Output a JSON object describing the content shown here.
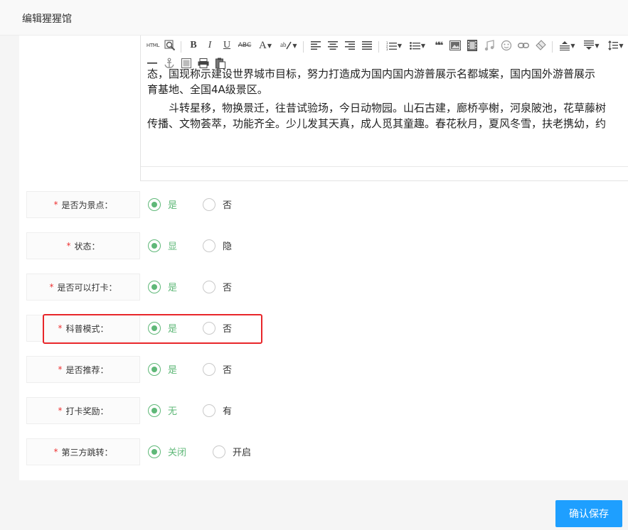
{
  "dialog": {
    "title": "编辑猩猩馆"
  },
  "editor": {
    "toolbar": {
      "html_label": "HTML",
      "bold": "B",
      "italic": "I",
      "underline": "U",
      "strike": "ABC",
      "font_color": "A",
      "quote": "❝❝"
    },
    "content_lines": [
      "态，国现称示建设世界城市目标，努力打造成为国内国内游普展示名都城案，国内国外游普展示",
      "育基地、全国4A级景区。",
      "斗转星移，物换景迁，往昔试验场，今日动物园。山石古建，廊桥亭榭，河泉陂池，花草藤树",
      "传播、文物荟萃，功能齐全。少儿发其天真，成人觅其童趣。春花秋月，夏风冬雪，扶老携幼，约"
    ]
  },
  "fields": [
    {
      "label": "是否为景点：",
      "options": [
        "是",
        "否"
      ],
      "selected": 0
    },
    {
      "label": "状态：",
      "options": [
        "显",
        "隐"
      ],
      "selected": 0
    },
    {
      "label": "是否可以打卡：",
      "options": [
        "是",
        "否"
      ],
      "selected": 0
    },
    {
      "label": "科普模式：",
      "options": [
        "是",
        "否"
      ],
      "selected": 0
    },
    {
      "label": "是否推荐：",
      "options": [
        "是",
        "否"
      ],
      "selected": 0
    },
    {
      "label": "打卡奖励：",
      "options": [
        "无",
        "有"
      ],
      "selected": 0
    },
    {
      "label": "第三方跳转：",
      "options": [
        "关闭",
        "开启"
      ],
      "selected": 0
    }
  ],
  "required_mark": "*",
  "colors": {
    "accent": "#5fb878",
    "primary_button": "#1e9fff",
    "highlight": "#e8262a",
    "required": "#e33333"
  },
  "footer": {
    "confirm_label": "确认保存"
  }
}
